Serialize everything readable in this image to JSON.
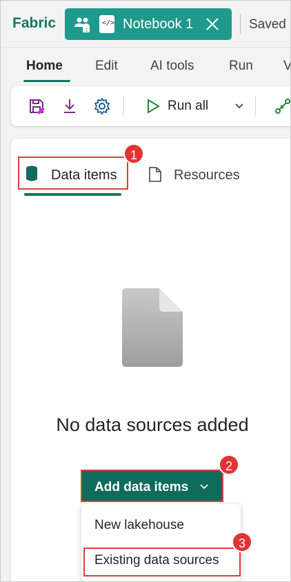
{
  "header": {
    "brand": "Fabric",
    "notebook_tab_title": "Notebook 1",
    "status": "Saved",
    "notebook_icon_glyph": "</>",
    "accent_color": "#1e9a8c",
    "brand_color": "#117865"
  },
  "menu": {
    "items": [
      {
        "label": "Home",
        "active": true
      },
      {
        "label": "Edit"
      },
      {
        "label": "AI tools"
      },
      {
        "label": "Run"
      },
      {
        "label": "V"
      }
    ]
  },
  "toolbar": {
    "icons": [
      "save-icon",
      "download-icon",
      "settings-icon",
      "play-icon",
      "chevron-down-icon",
      "connect-icon"
    ],
    "run_all_label": "Run all"
  },
  "explorer": {
    "tabs": [
      {
        "label": "Data items",
        "active": true,
        "icon": "database-icon"
      },
      {
        "label": "Resources",
        "icon": "document-icon"
      }
    ],
    "empty_state_title": "No data sources added",
    "add_button_label": "Add data items",
    "dropdown_items": [
      "New lakehouse",
      "Existing data sources"
    ]
  },
  "callouts": [
    "1",
    "2",
    "3"
  ],
  "callout_color": "#e03434"
}
